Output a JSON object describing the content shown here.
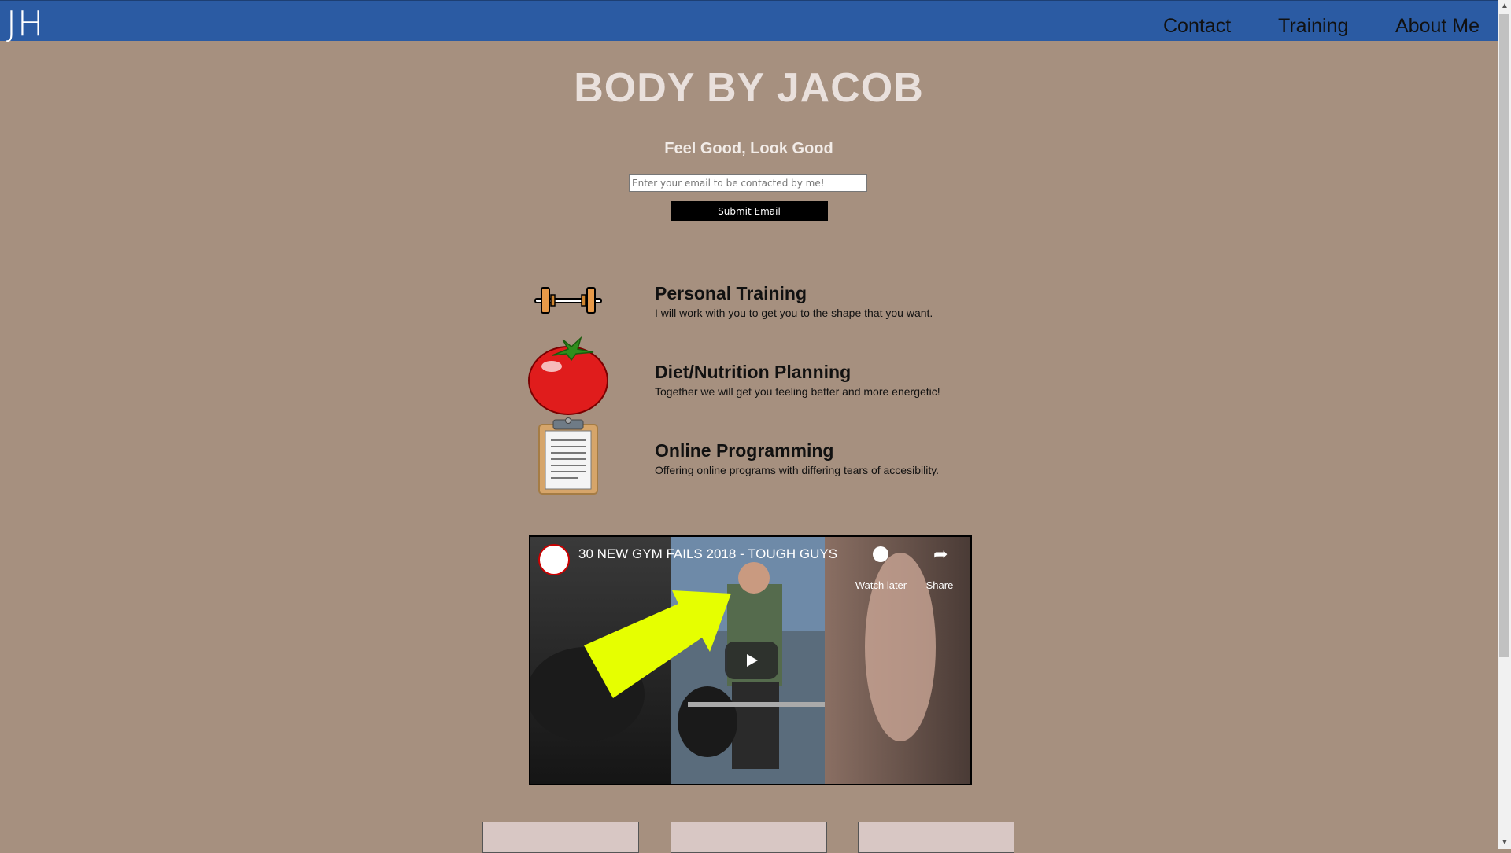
{
  "header": {
    "logo": "JH",
    "nav": [
      "Contact",
      "Training",
      "About Me"
    ]
  },
  "hero": {
    "title": "BODY BY JACOB",
    "tagline": "Feel Good, Look Good",
    "email_placeholder": "Enter your email to be contacted by me!",
    "submit_label": "Submit Email"
  },
  "services": [
    {
      "icon": "barbell-icon",
      "title": "Personal Training",
      "desc": "I will work with you to get you to the shape that you want."
    },
    {
      "icon": "tomato-icon",
      "title": "Diet/Nutrition Planning",
      "desc": "Together we will get you feeling better and more energetic!"
    },
    {
      "icon": "clipboard-icon",
      "title": "Online Programming",
      "desc": "Offering online programs with differing tears of accesibility."
    }
  ],
  "video": {
    "title": "30 NEW GYM FAILS 2018 - TOUGH GUYS",
    "watch_later": "Watch later",
    "share": "Share"
  },
  "colors": {
    "background": "#a6907f",
    "nav_bar": "#2b5ba3",
    "accent": "#e6ff00"
  }
}
